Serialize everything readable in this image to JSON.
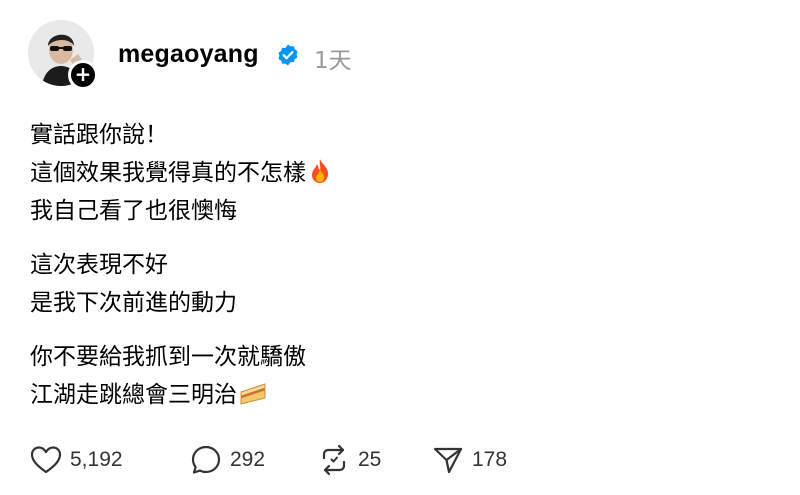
{
  "post": {
    "username": "megaoyang",
    "time": "1天",
    "paragraphs": [
      [
        "實話跟你說！",
        "這個效果我覺得真的不怎樣",
        "我自己看了也很懊悔"
      ],
      [
        "這次表現不好",
        "是我下次前進的動力"
      ],
      [
        "你不要給我抓到一次就驕傲",
        "江湖走跳總會三明治"
      ]
    ]
  },
  "actions": {
    "likes": "5,192",
    "comments": "292",
    "reposts": "25",
    "shares": "178"
  },
  "icons": {
    "verified": "verified-badge-icon",
    "fire": "fire-emoji",
    "sandwich": "sandwich-emoji",
    "like": "heart-icon",
    "comment": "comment-bubble-icon",
    "repost": "repost-icon",
    "share": "send-icon"
  },
  "colors": {
    "verified": "#0095f6",
    "muted": "#9a9a9a"
  }
}
